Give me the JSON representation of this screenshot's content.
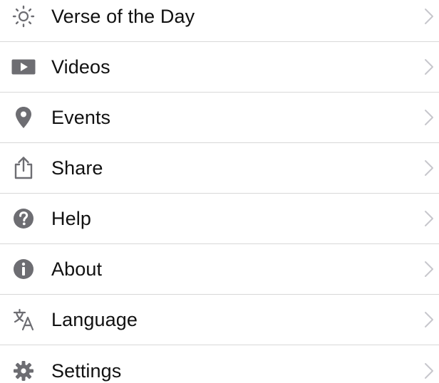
{
  "menu": {
    "items": [
      {
        "label": "Verse of the Day",
        "icon": "sun-icon"
      },
      {
        "label": "Videos",
        "icon": "video-play-icon"
      },
      {
        "label": "Events",
        "icon": "location-pin-icon"
      },
      {
        "label": "Share",
        "icon": "share-icon"
      },
      {
        "label": "Help",
        "icon": "help-icon"
      },
      {
        "label": "About",
        "icon": "info-icon"
      },
      {
        "label": "Language",
        "icon": "translate-icon"
      },
      {
        "label": "Settings",
        "icon": "gear-icon"
      }
    ]
  },
  "colors": {
    "icon": "#6d6d72",
    "chevron": "#c7c7cc",
    "divider": "#d8d8d8",
    "text": "#111111",
    "background": "#ffffff"
  }
}
